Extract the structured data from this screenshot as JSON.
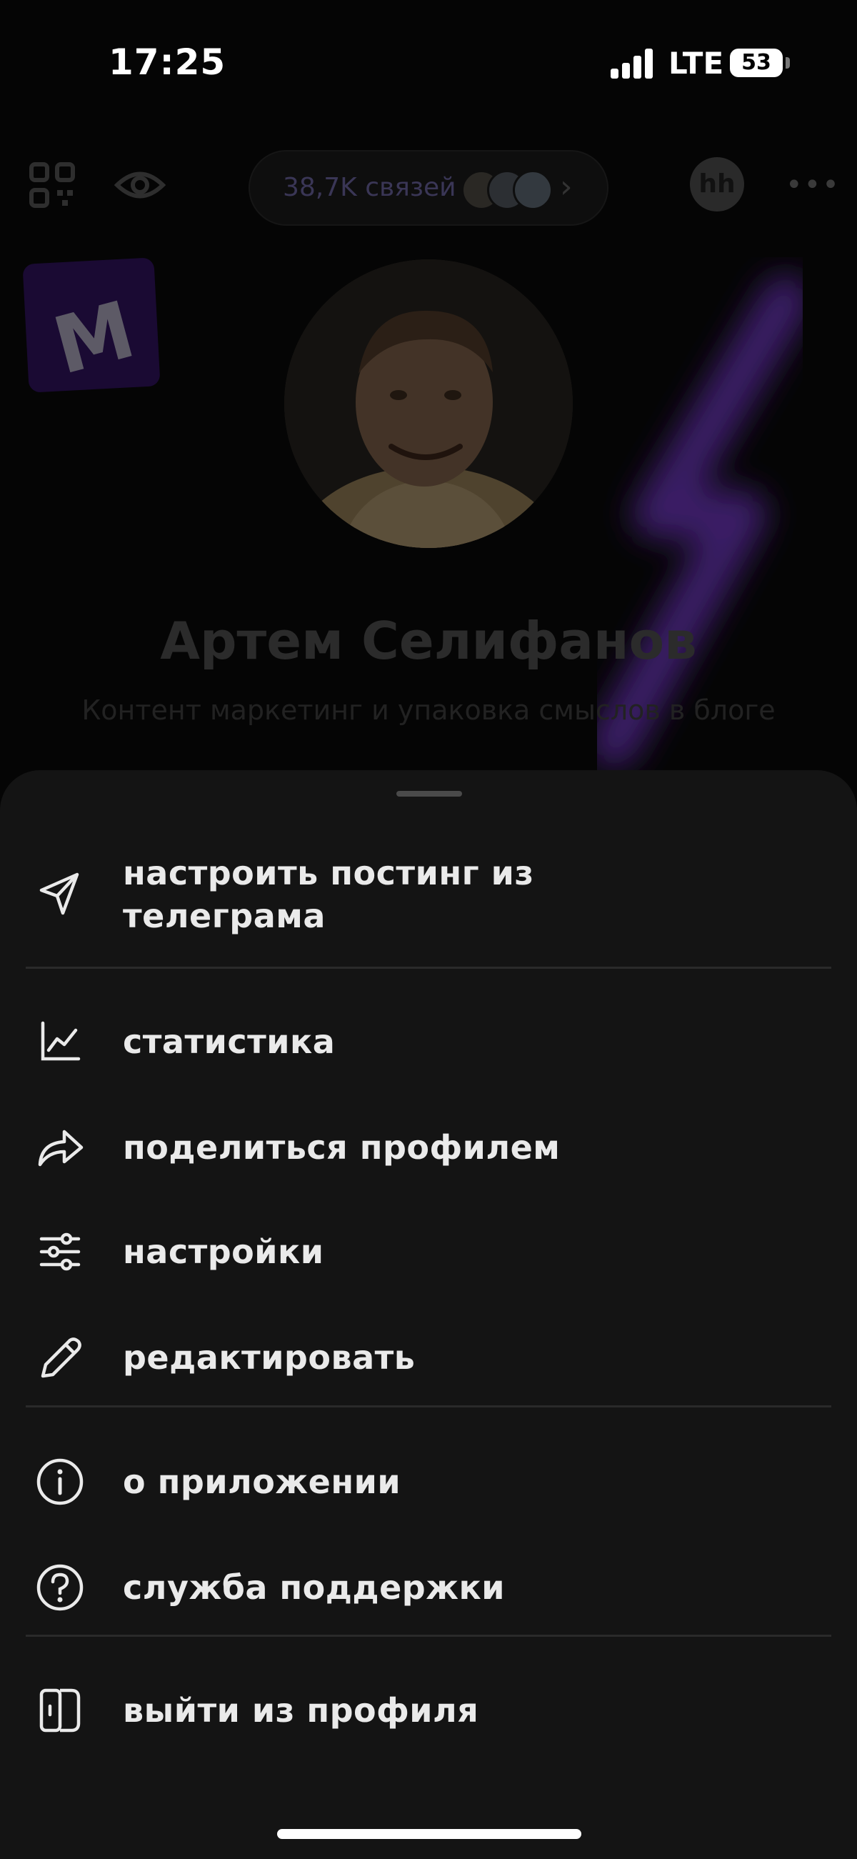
{
  "status_bar": {
    "time": "17:25",
    "network": "LTE",
    "battery": "53"
  },
  "profile": {
    "connections_label": "38,7K связей",
    "name": "Артем Селифанов",
    "bio": "Контент маркетинг и упаковка смыслов в блоге",
    "hh_badge": "hh",
    "sticker_letter": "M"
  },
  "menu": {
    "items": [
      {
        "label": "настроить постинг из телеграма",
        "icon": "paper-plane-icon"
      },
      {
        "label": "статистика",
        "icon": "line-chart-icon"
      },
      {
        "label": "поделиться профилем",
        "icon": "share-arrow-icon"
      },
      {
        "label": "настройки",
        "icon": "sliders-icon"
      },
      {
        "label": "редактировать",
        "icon": "pencil-icon"
      },
      {
        "label": "о приложении",
        "icon": "info-icon"
      },
      {
        "label": "служба поддержки",
        "icon": "help-icon"
      },
      {
        "label": "выйти из профиля",
        "icon": "logout-door-icon"
      }
    ]
  },
  "colors": {
    "sheet_bg": "#141414",
    "accent_purple": "#5a2a99",
    "text": "#eaeaea"
  }
}
